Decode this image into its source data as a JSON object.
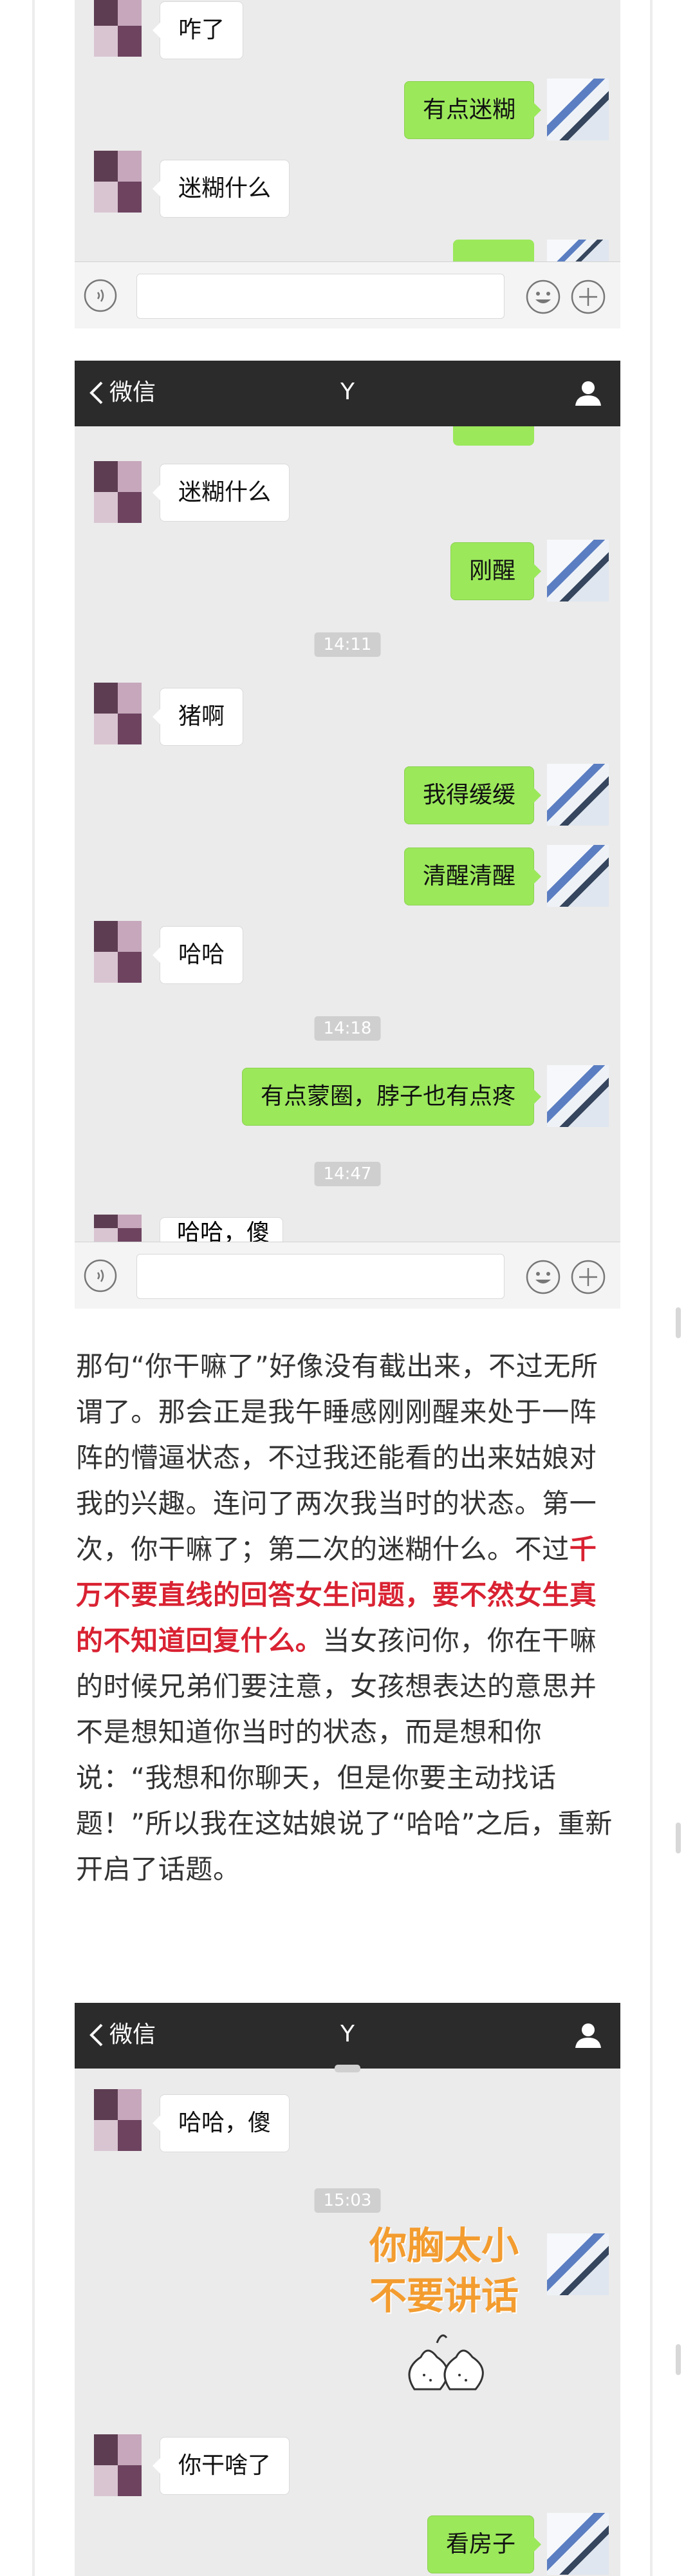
{
  "colors": {
    "titlebar_bg": "#2b2b2b",
    "chat_bg": "#ebebeb",
    "bubble_self": "#9be85b",
    "bubble_other": "#ffffff",
    "highlight_text": "#d92232",
    "sticker_text": "#f39c2f"
  },
  "titlebar": {
    "back_label": "微信",
    "contact_name": "Y"
  },
  "shot1": {
    "messages": [
      {
        "side": "left",
        "text": "咋了"
      },
      {
        "side": "right",
        "text": "有点迷糊"
      },
      {
        "side": "left",
        "text": "迷糊什么"
      }
    ]
  },
  "shot2": {
    "messages": [
      {
        "side": "left",
        "text": "迷糊什么"
      },
      {
        "side": "right",
        "text": "刚醒"
      },
      {
        "side": "time",
        "text": "14:11"
      },
      {
        "side": "left",
        "text": "猪啊"
      },
      {
        "side": "right",
        "text": "我得缓缓"
      },
      {
        "side": "right",
        "text": "清醒清醒"
      },
      {
        "side": "left",
        "text": "哈哈"
      },
      {
        "side": "time",
        "text": "14:18"
      },
      {
        "side": "right",
        "text": "有点蒙圈，脖子也有点疼"
      },
      {
        "side": "time",
        "text": "14:47"
      },
      {
        "side": "left",
        "text": "哈哈，傻"
      }
    ]
  },
  "article": {
    "p1": "那句“你干嘛了”好像没有截出来，不过无所谓了。那会正是我午睡感刚刚醒来处于一阵阵的懵逼状态，不过我还能看的出来姑娘对我的兴趣。连问了两次我当时的状态。第一次，你干嘛了；第二次的迷糊什么。不过",
    "highlight": "千万不要直线的回答女生问题，要不然女生真的不知道回复什么。",
    "p2": "当女孩问你，你在干嘛的时候兄弟们要注意，女孩想表达的意思并不是想知道你当时的状态，而是想和你说：“我想和你聊天，但是你要主动找话题！”所以我在这姑娘说了“哈哈”之后，重新开启了话题。"
  },
  "shot3": {
    "messages": [
      {
        "side": "left",
        "text": "哈哈，傻"
      },
      {
        "side": "time",
        "text": "15:03"
      },
      {
        "side": "left",
        "text": "你干啥了"
      },
      {
        "side": "right",
        "text": "看房子"
      }
    ],
    "sticker": {
      "line1": "你胸太小",
      "line2": "不要讲话"
    }
  },
  "icons": [
    "back-chevron-icon",
    "user-profile-icon",
    "voice-icon",
    "emoji-icon",
    "plus-icon",
    "pear-sticker-icon"
  ]
}
